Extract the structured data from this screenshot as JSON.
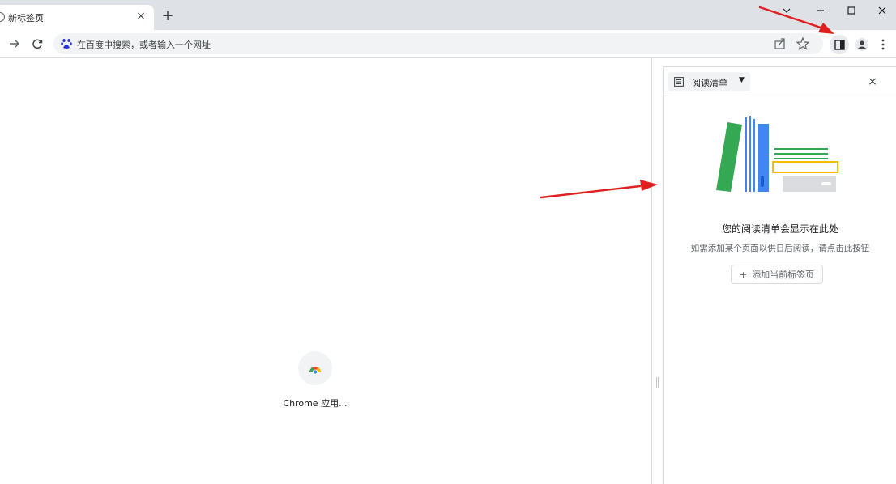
{
  "tab": {
    "title": "新标签页",
    "close": "×"
  },
  "newtab": {
    "label": "+"
  },
  "omnibox": {
    "placeholder": "在百度中搜索，或者输入一个网址"
  },
  "app": {
    "label": "Chrome 应用..."
  },
  "sidepanel": {
    "selector_label": "阅读清单",
    "close": "×",
    "title": "您的阅读清单会显示在此处",
    "subtitle": "如需添加某个页面以供日后阅读，请点击此按钮",
    "add_button_label": "添加当前标签页",
    "add_button_icon": "+"
  },
  "icons": {
    "back": "arrow-left-icon",
    "forward": "arrow-right-icon",
    "reload": "reload-icon",
    "search_engine": "baidu-paw-icon",
    "share": "share-icon",
    "star": "star-icon",
    "side_panel": "side-panel-icon",
    "profile": "profile-icon",
    "menu": "more-vert-icon"
  },
  "colors": {
    "tabstrip_bg": "#dee1e6",
    "omnibox_bg": "#f1f3f4",
    "annotation_arrow": "#e02020",
    "book_green": "#34a853",
    "book_blue": "#4285f4",
    "book_yellow": "#fbbc04"
  }
}
